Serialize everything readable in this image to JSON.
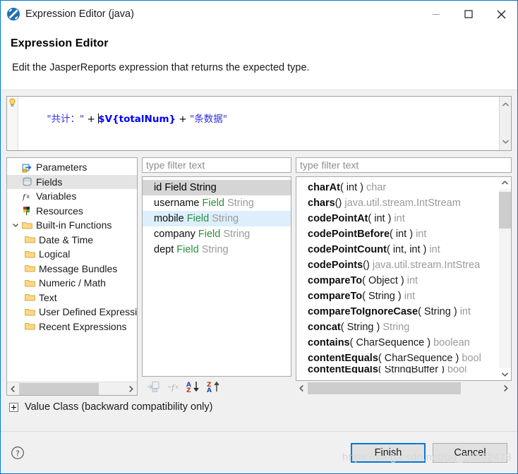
{
  "window": {
    "title": "Expression Editor (java)",
    "app_icon": "jaspersoft-icon",
    "controls": {
      "minimize": "minimize-icon",
      "maximize": "maximize-icon",
      "close": "close-icon"
    }
  },
  "header": {
    "title": "Expression Editor",
    "description": "Edit the JasperReports expression that returns the expected type."
  },
  "expression": {
    "hint_icon": "lightbulb-icon",
    "tokens": [
      {
        "text": "\"共计：\"",
        "kind": "string"
      },
      {
        "text": " + ",
        "kind": "operator"
      },
      {
        "text": "$V{totalNum}",
        "kind": "variable"
      },
      {
        "text": " + ",
        "kind": "operator"
      },
      {
        "text": "\"条数据\"",
        "kind": "string"
      }
    ],
    "plain": "\"共计：\" + $V{totalNum} + \"条数据\"",
    "scroll_up_icon": "chevron-up-icon",
    "scroll_down_icon": "chevron-down-icon"
  },
  "tree": {
    "items": [
      {
        "label": "Parameters",
        "icon": "parameters-icon",
        "indent": 0,
        "selected": false,
        "twisty": ""
      },
      {
        "label": "Fields",
        "icon": "fields-icon",
        "indent": 0,
        "selected": true,
        "twisty": ""
      },
      {
        "label": "Variables",
        "icon": "variables-icon",
        "indent": 0,
        "selected": false,
        "twisty": ""
      },
      {
        "label": "Resources",
        "icon": "resources-icon",
        "indent": 0,
        "selected": false,
        "twisty": ""
      },
      {
        "label": "Built-in Functions",
        "icon": "folder-icon",
        "indent": 0,
        "selected": false,
        "twisty": "expanded"
      },
      {
        "label": "Date & Time",
        "icon": "folder-icon",
        "indent": 1,
        "selected": false,
        "twisty": ""
      },
      {
        "label": "Logical",
        "icon": "folder-icon",
        "indent": 1,
        "selected": false,
        "twisty": ""
      },
      {
        "label": "Message Bundles",
        "icon": "folder-icon",
        "indent": 1,
        "selected": false,
        "twisty": ""
      },
      {
        "label": "Numeric / Math",
        "icon": "folder-icon",
        "indent": 1,
        "selected": false,
        "twisty": ""
      },
      {
        "label": "Text",
        "icon": "folder-icon",
        "indent": 1,
        "selected": false,
        "twisty": ""
      },
      {
        "label": "User Defined Expressions",
        "icon": "folder-icon",
        "indent": 0,
        "selected": false,
        "twisty": ""
      },
      {
        "label": "Recent Expressions",
        "icon": "folder-icon",
        "indent": 0,
        "selected": false,
        "twisty": ""
      }
    ],
    "hscroll": {
      "left_icon": "chevron-left-icon",
      "right_icon": "chevron-right-icon"
    }
  },
  "middle_panel": {
    "filter_placeholder": "type filter text",
    "items": [
      {
        "name": "id",
        "kind": "Field",
        "type": "String",
        "state": "selected"
      },
      {
        "name": "username",
        "kind": "Field",
        "type": "String",
        "state": "none"
      },
      {
        "name": "mobile",
        "kind": "Field",
        "type": "String",
        "state": "hover"
      },
      {
        "name": "company",
        "kind": "Field",
        "type": "String",
        "state": "none"
      },
      {
        "name": "dept",
        "kind": "Field",
        "type": "String",
        "state": "none"
      }
    ],
    "toolbar": [
      {
        "icon": "insert-parameter-icon",
        "enabled": false
      },
      {
        "icon": "insert-function-icon",
        "enabled": false
      },
      {
        "icon": "sort-ascending-icon",
        "enabled": true
      },
      {
        "icon": "sort-descending-icon",
        "enabled": true
      }
    ]
  },
  "right_panel": {
    "filter_placeholder": "type filter text",
    "items": [
      {
        "name": "charAt",
        "args": "( int )",
        "ret": "char"
      },
      {
        "name": "chars",
        "args": "()",
        "ret": "java.util.stream.IntStream"
      },
      {
        "name": "codePointAt",
        "args": "( int )",
        "ret": "int"
      },
      {
        "name": "codePointBefore",
        "args": "( int )",
        "ret": "int"
      },
      {
        "name": "codePointCount",
        "args": "( int, int )",
        "ret": "int"
      },
      {
        "name": "codePoints",
        "args": "()",
        "ret": "java.util.stream.IntStrea"
      },
      {
        "name": "compareTo",
        "args": "( Object )",
        "ret": "int"
      },
      {
        "name": "compareTo",
        "args": "( String )",
        "ret": "int"
      },
      {
        "name": "compareToIgnoreCase",
        "args": "( String )",
        "ret": "int"
      },
      {
        "name": "concat",
        "args": "( String )",
        "ret": "String"
      },
      {
        "name": "contains",
        "args": "( CharSequence )",
        "ret": "boolean"
      },
      {
        "name": "contentEquals",
        "args": "( CharSequence )",
        "ret": "bool"
      },
      {
        "name": "contentEquals",
        "args": "( StringBuffer )",
        "ret": "bool"
      }
    ],
    "scroll_up_icon": "chevron-up-icon",
    "scroll_down_icon": "chevron-down-icon",
    "hscroll": {
      "left_icon": "chevron-left-icon",
      "right_icon": "chevron-right-icon"
    }
  },
  "value_class": {
    "label": "Value Class (backward compatibility only)",
    "expander": "plus-expander-icon",
    "expanded": false
  },
  "footer": {
    "help_icon": "help-icon",
    "finish_label": "Finish",
    "cancel_label": "Cancel"
  },
  "watermark": "https://blog.csdn.net/qq_36662478",
  "colors": {
    "accent": "#0078d7",
    "string_token": "#2f2fe0",
    "variable_token": "#0000ff",
    "field_kind": "#2e8b3d",
    "field_type": "#9a9a9a",
    "selection_gray": "#d5d5d5",
    "hover_blue": "#ddeffc"
  }
}
